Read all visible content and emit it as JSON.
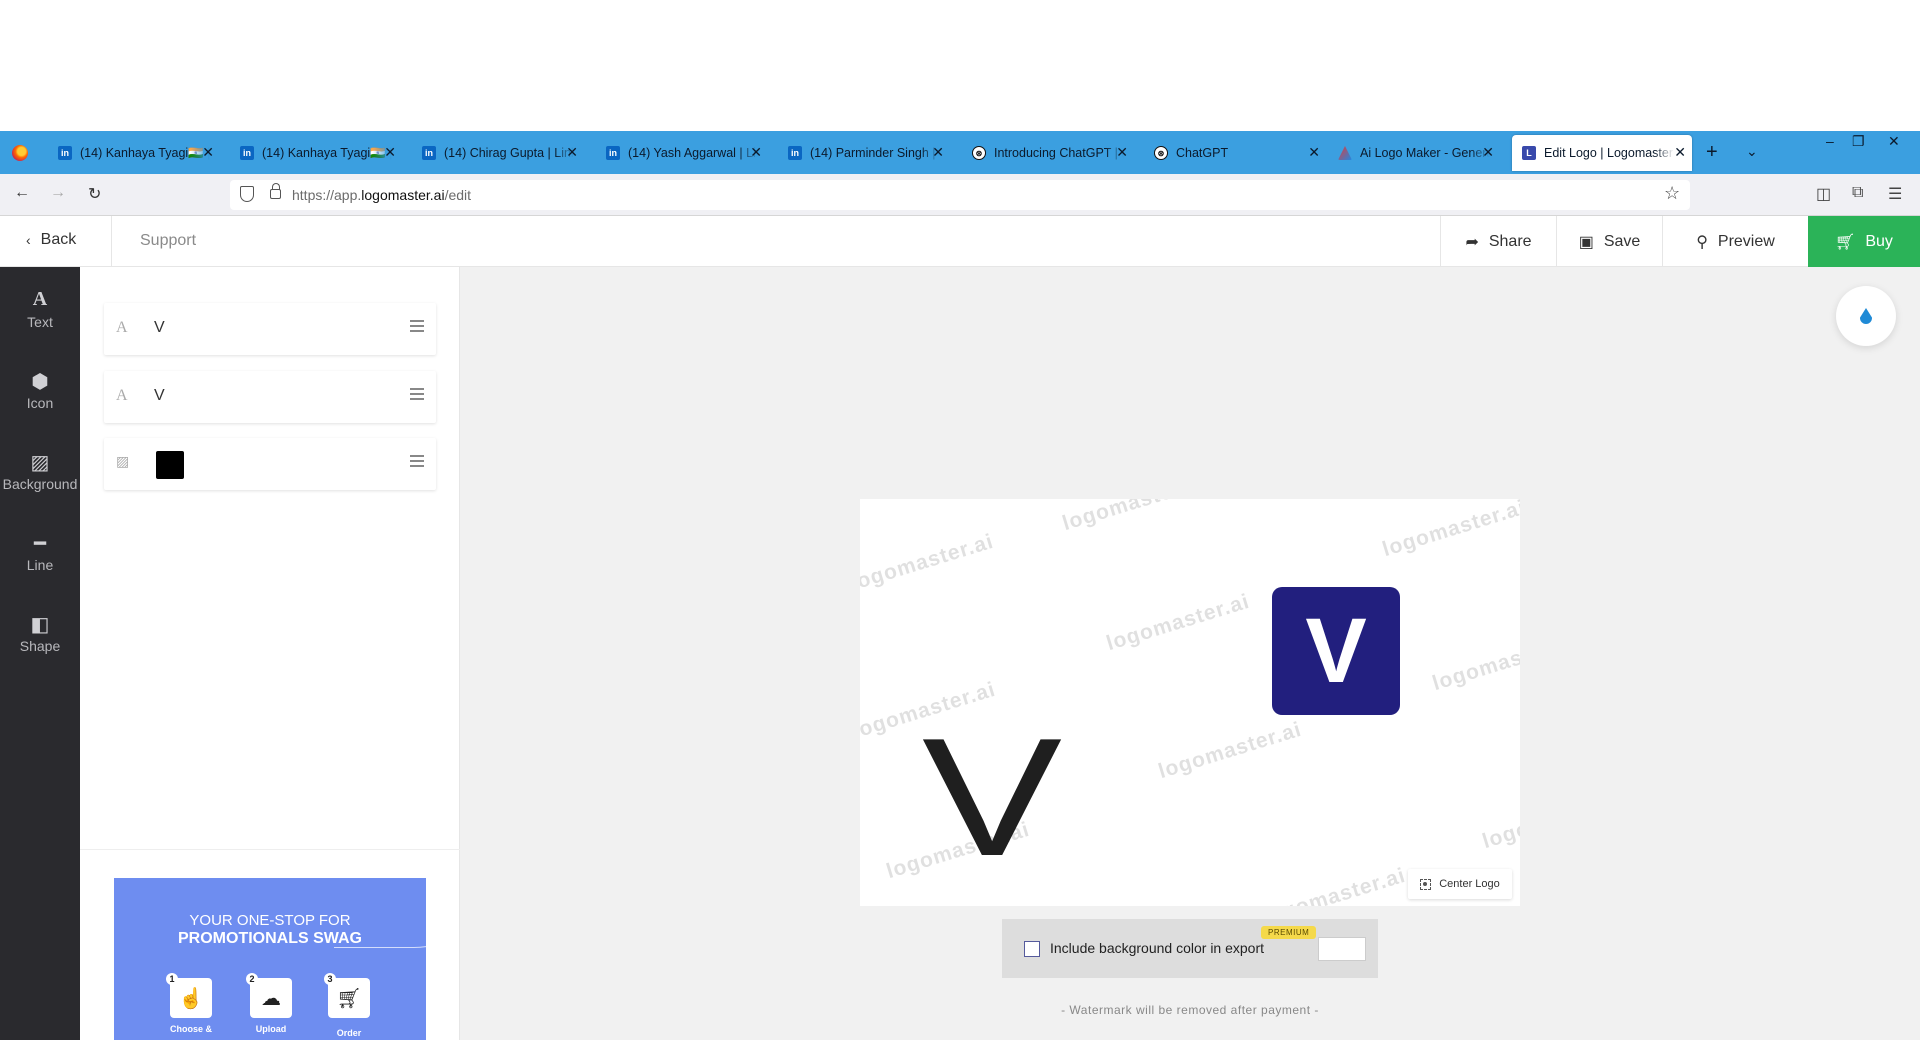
{
  "browser": {
    "tabs": [
      {
        "title": "(14) Kanhaya Tyagi🇮🇳 | L",
        "icon": "linkedin-icon"
      },
      {
        "title": "(14) Kanhaya Tyagi🇮🇳 | L",
        "icon": "linkedin-icon"
      },
      {
        "title": "(14) Chirag Gupta | Link",
        "icon": "linkedin-icon"
      },
      {
        "title": "(14) Yash Aggarwal | Lin",
        "icon": "linkedin-icon"
      },
      {
        "title": "(14) Parminder Singh | L",
        "icon": "linkedin-icon"
      },
      {
        "title": "Introducing ChatGPT | (",
        "icon": "openai-icon"
      },
      {
        "title": "ChatGPT",
        "icon": "openai-icon"
      },
      {
        "title": "Ai Logo Maker - Genera",
        "icon": "ailogo-icon"
      },
      {
        "title": "Edit Logo | Logomaster",
        "icon": "logomaster-icon",
        "active": true
      }
    ],
    "url_prefix": "https://app.",
    "url_domain": "logomaster.ai",
    "url_path": "/edit"
  },
  "header": {
    "back_label": "Back",
    "support_label": "Support",
    "share_label": "Share",
    "save_label": "Save",
    "preview_label": "Preview",
    "buy_label": "Buy",
    "buy_color": "#2bb358"
  },
  "rail": {
    "items": [
      {
        "label": "Text",
        "icon": "text-icon"
      },
      {
        "label": "Icon",
        "icon": "cube-icon"
      },
      {
        "label": "Background",
        "icon": "image-icon"
      },
      {
        "label": "Line",
        "icon": "line-icon"
      },
      {
        "label": "Shape",
        "icon": "shape-icon"
      }
    ]
  },
  "layers": [
    {
      "type": "text",
      "label": "V"
    },
    {
      "type": "text",
      "label": "V"
    },
    {
      "type": "background",
      "color": "#000000"
    }
  ],
  "ad": {
    "line1": "YOUR ONE-STOP FOR",
    "line2": "PROMOTIONALS SWAG",
    "steps": [
      {
        "num": "1",
        "caption": "Choose &"
      },
      {
        "num": "2",
        "caption": "Upload"
      },
      {
        "num": "3",
        "caption": "Order"
      }
    ]
  },
  "canvas": {
    "watermark": "logomaster.ai",
    "big_letter": "V",
    "logo_letter": "V",
    "logo_color": "#221f7e",
    "center_logo_label": "Center Logo"
  },
  "export": {
    "checkbox_label": "Include background color in export",
    "premium_badge": "PREMIUM",
    "note": "- Watermark will be removed after payment -"
  }
}
